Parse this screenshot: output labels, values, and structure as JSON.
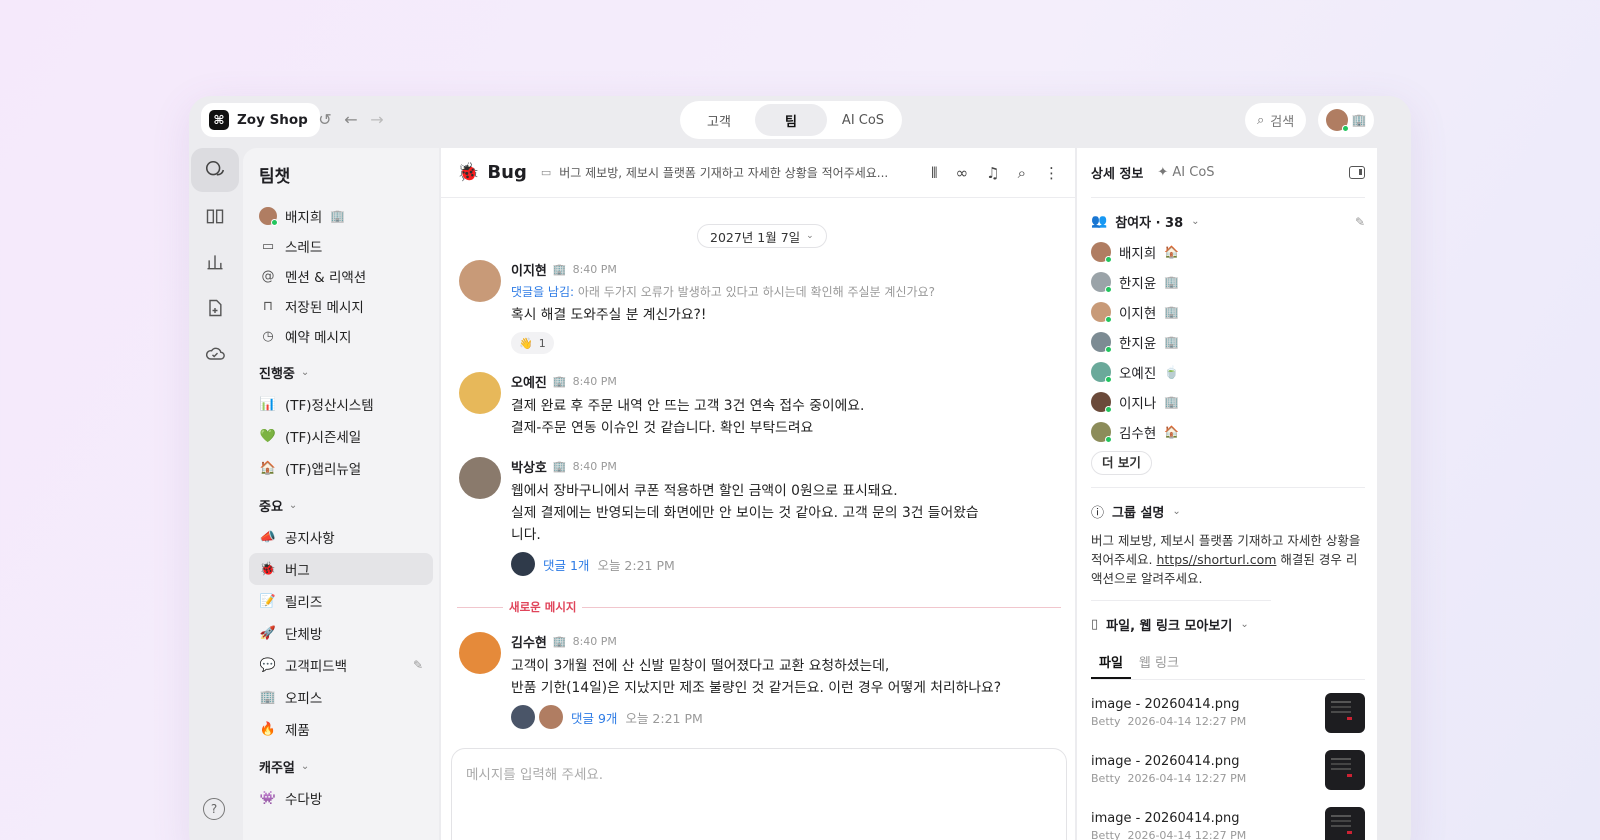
{
  "topbar": {
    "brand": "Zoy Shop",
    "tabs": [
      {
        "label": "고객",
        "active": false
      },
      {
        "label": "팀",
        "active": true
      },
      {
        "label": "AI CoS",
        "active": false
      }
    ],
    "search_label": "검색"
  },
  "sidebar": {
    "title": "팀챗",
    "top_items": [
      {
        "label": "배지희",
        "icon": "avatar",
        "badge": "🏢"
      },
      {
        "label": "스레드",
        "icon": "thread-icon"
      },
      {
        "label": "멘션 & 리액션",
        "icon": "at-icon"
      },
      {
        "label": "저장된 메시지",
        "icon": "bookmark-icon"
      },
      {
        "label": "예약 메시지",
        "icon": "clock-icon"
      }
    ],
    "sections": [
      {
        "title": "진행중",
        "items": [
          {
            "emoji": "📊",
            "label": "(TF)정산시스템"
          },
          {
            "emoji": "💚",
            "label": "(TF)시즌세일"
          },
          {
            "emoji": "🏠",
            "label": "(TF)앱리뉴얼"
          }
        ]
      },
      {
        "title": "중요",
        "items": [
          {
            "emoji": "📣",
            "label": "공지사항"
          },
          {
            "emoji": "🐞",
            "label": "버그",
            "active": true
          },
          {
            "emoji": "📝",
            "label": "릴리즈"
          },
          {
            "emoji": "🚀",
            "label": "단체방"
          },
          {
            "emoji": "💬",
            "label": "고객피드백",
            "editable": true
          },
          {
            "emoji": "🏢",
            "label": "오피스"
          },
          {
            "emoji": "🔥",
            "label": "제품"
          }
        ]
      },
      {
        "title": "캐주얼",
        "items": [
          {
            "emoji": "👾",
            "label": "수다방"
          }
        ]
      }
    ]
  },
  "chat": {
    "channel_emoji": "🐞",
    "channel_name": "Bug",
    "channel_desc": "버그 제보방, 제보시 플랫폼 기재하고 자세한 상황을 적어주세요...",
    "date": "2027년 1월 7일",
    "messages": [
      {
        "author": "이지현",
        "badge": "🏢",
        "time": "8:40 PM",
        "reply_label": "댓글을 남김:",
        "reply_text": "아래 두가지 오류가 발생하고 있다고 하시는데 확인해 주실분 계신가요?",
        "lines": [
          "혹시 해결 도와주실 분 계신가요?!"
        ],
        "reaction": {
          "emoji": "👋",
          "count": "1"
        },
        "avatar_color": "#c89a78"
      },
      {
        "author": "오예진",
        "badge": "🏢",
        "time": "8:40 PM",
        "lines": [
          "결제 완료 후 주문 내역 안 뜨는 고객 3건 연속 접수 중이에요.",
          "결제-주문 연동 이슈인 것 같습니다. 확인 부탁드려요"
        ],
        "avatar_color": "#e7b85a"
      },
      {
        "author": "박상호",
        "badge": "🏢",
        "time": "8:40 PM",
        "lines": [
          "웹에서 장바구니에서 쿠폰 적용하면 할인 금액이 0원으로 표시돼요.",
          "실제 결제에는 반영되는데 화면에만 안 보이는 것 같아요. 고객 문의 3건 들어왔습",
          "니다."
        ],
        "thread": {
          "count": "댓글 1개",
          "time": "오늘 2:21 PM"
        },
        "avatar_color": "#8a7a6c"
      },
      {
        "author": "김수현",
        "badge": "🏢",
        "time": "8:40 PM",
        "lines": [
          "고객이 3개월 전에 산 신발 밑창이 떨어졌다고 교환 요청하셨는데,",
          "반품 기한(14일)은 지났지만 제조 불량인 것 같거든요. 이런 경우 어떻게 처리하나요?"
        ],
        "thread": {
          "count": "댓글 9개",
          "time": "오늘 2:21 PM"
        },
        "avatar_color": "#e58a3a"
      }
    ],
    "new_divider": "새로운 메시지",
    "composer_placeholder": "메시지를 입력해 주세요."
  },
  "details": {
    "tab_info": "상세 정보",
    "tab_ai": "✦ AI CoS",
    "members_title": "참여자 · 38",
    "members": [
      {
        "name": "배지희",
        "badge": "🏠",
        "color": "#b07d62"
      },
      {
        "name": "한지윤",
        "badge": "🏢",
        "color": "#9aa3a8"
      },
      {
        "name": "이지현",
        "badge": "🏢",
        "color": "#c89a78"
      },
      {
        "name": "한지윤",
        "badge": "🏢",
        "color": "#7c8b93"
      },
      {
        "name": "오예진",
        "badge": "🍵",
        "color": "#6aa99a"
      },
      {
        "name": "이지나",
        "badge": "🏢",
        "color": "#6b4a3a"
      },
      {
        "name": "김수현",
        "badge": "🏠",
        "color": "#8c8c5a"
      }
    ],
    "more_label": "더 보기",
    "group_title": "그룹 설명",
    "group_desc_1": "버그 제보방, 제보시 플랫폼 기재하고 자세한 상황을 적어주세요.",
    "group_link": "https//shorturl.com",
    "group_desc_2": "해결된 경우 리액션으로 알려주세요.",
    "files_title": "파일, 웹 링크 모아보기",
    "file_tabs": [
      {
        "label": "파일",
        "active": true
      },
      {
        "label": "웹 링크",
        "active": false
      }
    ],
    "files": [
      {
        "name": "image - 20260414.png",
        "user": "Betty",
        "date": "2026-04-14",
        "time": "12:27 PM"
      },
      {
        "name": "image - 20260414.png",
        "user": "Betty",
        "date": "2026-04-14",
        "time": "12:27 PM"
      },
      {
        "name": "image - 20260414.png",
        "user": "Betty",
        "date": "2026-04-14",
        "time": "12:27 PM"
      }
    ]
  },
  "colors": {
    "accent_blue": "#2d7be5",
    "new_red": "#e0445a",
    "online_green": "#22c55e"
  }
}
